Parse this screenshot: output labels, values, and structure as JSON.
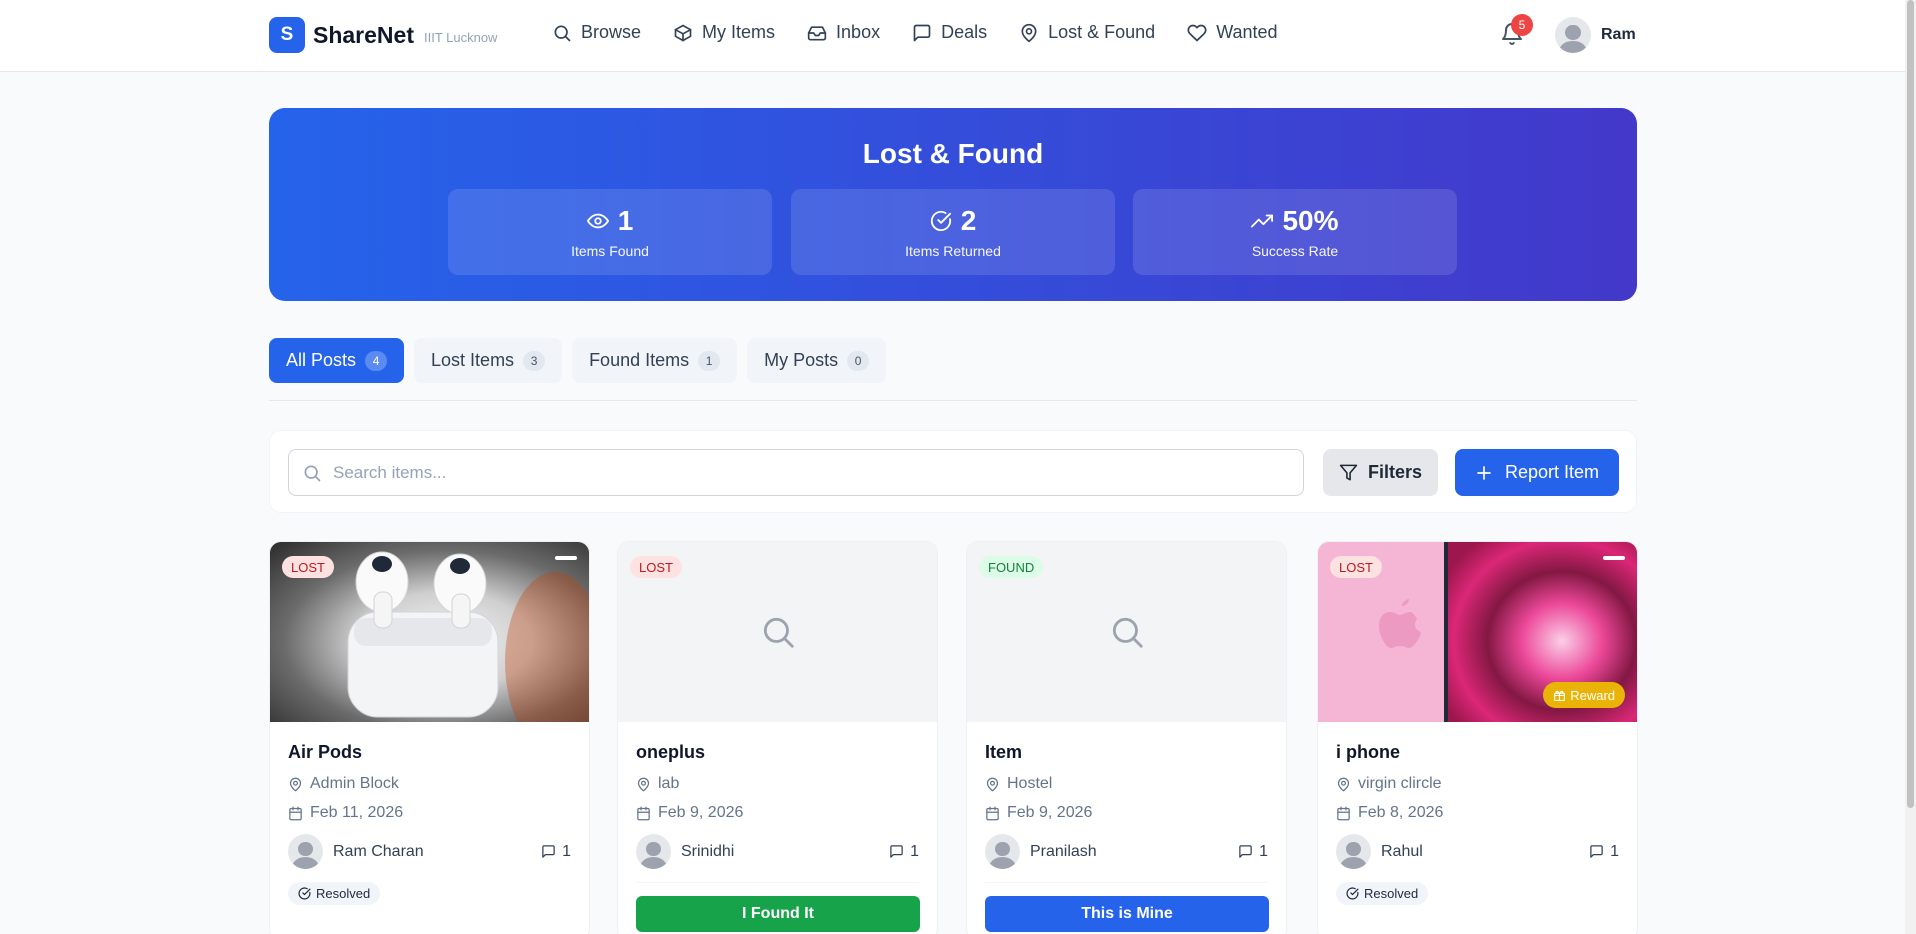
{
  "app": {
    "logo_letter": "S",
    "name": "ShareNet",
    "subtitle": "IIIT Lucknow"
  },
  "nav": [
    {
      "label": "Browse",
      "icon": "search-icon"
    },
    {
      "label": "My Items",
      "icon": "box-icon"
    },
    {
      "label": "Inbox",
      "icon": "inbox-icon"
    },
    {
      "label": "Deals",
      "icon": "chat-icon"
    },
    {
      "label": "Lost & Found",
      "icon": "map-pin-icon"
    },
    {
      "label": "Wanted",
      "icon": "heart-icon"
    }
  ],
  "notifications": {
    "count": "5"
  },
  "user": {
    "name": "Ram"
  },
  "hero": {
    "title": "Lost & Found",
    "stats": [
      {
        "value": "1",
        "label": "Items Found",
        "icon": "eye-icon"
      },
      {
        "value": "2",
        "label": "Items Returned",
        "icon": "check-circle-icon"
      },
      {
        "value": "50%",
        "label": "Success Rate",
        "icon": "trending-up-icon"
      }
    ]
  },
  "tabs": [
    {
      "label": "All Posts",
      "count": "4",
      "active": true
    },
    {
      "label": "Lost Items",
      "count": "3",
      "active": false
    },
    {
      "label": "Found Items",
      "count": "1",
      "active": false
    },
    {
      "label": "My Posts",
      "count": "0",
      "active": false
    }
  ],
  "search": {
    "placeholder": "Search items...",
    "value": "",
    "filters_label": "Filters",
    "report_label": "Report Item"
  },
  "cards": [
    {
      "status": "LOST",
      "title": "Air Pods",
      "location": "Admin Block",
      "date": "Feb 11, 2026",
      "owner": "Ram Charan",
      "comments": "1",
      "resolved": "Resolved",
      "action": ""
    },
    {
      "status": "LOST",
      "title": "oneplus",
      "location": "lab",
      "date": "Feb 9, 2026",
      "owner": "Srinidhi",
      "comments": "1",
      "resolved": "",
      "action": "I Found It"
    },
    {
      "status": "FOUND",
      "title": "Item",
      "location": "Hostel",
      "date": "Feb 9, 2026",
      "owner": "Pranilash",
      "comments": "1",
      "resolved": "",
      "action": "This is Mine"
    },
    {
      "status": "LOST",
      "title": "i phone",
      "location": "virgin clircle",
      "date": "Feb 8, 2026",
      "owner": "Rahul",
      "comments": "1",
      "resolved": "Resolved",
      "action": "",
      "reward": "Reward"
    }
  ],
  "colors": {
    "primary": "#2563eb",
    "hero_end": "#4338ca",
    "lost": "#b91c1c",
    "found": "#15803d",
    "success": "#16a34a",
    "reward": "#eab308",
    "notification": "#ef4444"
  }
}
